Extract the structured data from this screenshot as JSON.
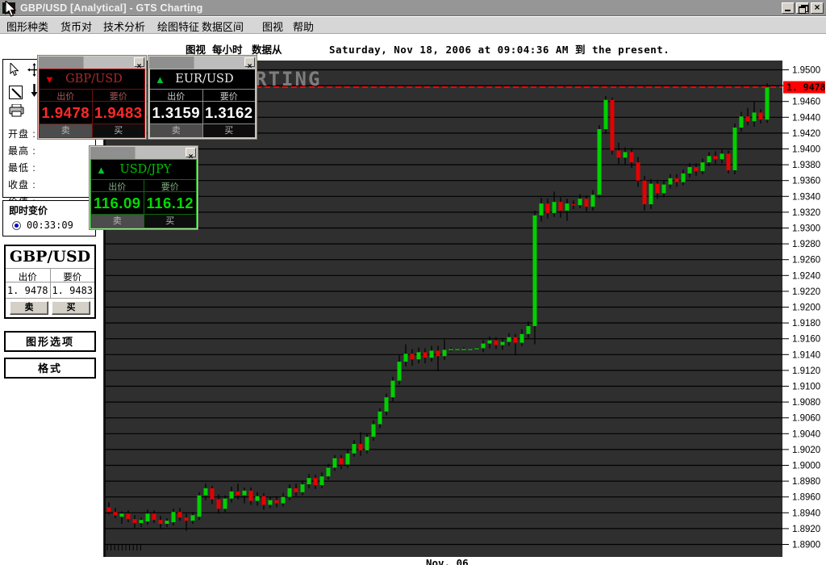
{
  "window": {
    "title": "GBP/USD [Analytical]  - GTS Charting"
  },
  "menu": {
    "items": [
      "图形种类",
      "货币对",
      "技术分析",
      "绘图特征",
      "数据区间",
      "图视",
      "帮助"
    ]
  },
  "info_bar": {
    "view": "图视",
    "interval": "每小时",
    "from_label": "数据从",
    "range": "Saturday, Nov 18, 2006 at 09:04:36 AM 到  the present."
  },
  "quote_panels": [
    {
      "pair": "GBP/USD",
      "direction": "down",
      "bid_label": "出价",
      "ask_label": "要价",
      "bid": "1.9478",
      "ask": "1.9483",
      "sell": "卖",
      "buy": "买",
      "accent": "#ff2a2a"
    },
    {
      "pair": "EUR/USD",
      "direction": "up",
      "bid_label": "出价",
      "ask_label": "要价",
      "bid": "1.3159",
      "ask": "1.3162",
      "sell": "卖",
      "buy": "买",
      "accent": "#ffffff"
    },
    {
      "pair": "USD/JPY",
      "direction": "up",
      "bid_label": "出价",
      "ask_label": "要价",
      "bid": "116.09",
      "ask": "116.12",
      "sell": "卖",
      "buy": "买",
      "accent": "#00dc00"
    }
  ],
  "sidebar": {
    "stats": [
      "开盘 :",
      "最高 :",
      "最低 :",
      "收盘 :",
      "价值 :"
    ],
    "tick_panel": {
      "label": "即时变价",
      "time": "00:33:09"
    },
    "quote_box": {
      "pair": "GBP/USD",
      "bid_label": "出价",
      "ask_label": "要价",
      "bid": "1. 9478",
      "ask": "1. 9483",
      "sell": "卖",
      "buy": "买"
    },
    "buttons": {
      "graph_options": "图形选项",
      "format": "格式"
    }
  },
  "chart_data": {
    "type": "candlestick",
    "pair": "GBP/USD",
    "interval": "hourly",
    "watermark": "GTS CHARTING",
    "x_label": "Nov, 06",
    "y_axis": {
      "min": 1.89,
      "max": 1.95,
      "tick_step": 0.002
    },
    "current_price": 1.9478,
    "price_tag": "1. 9478",
    "colors": {
      "background": "#2f2f2f",
      "grid": "#000000",
      "up": "#00d000",
      "down": "#e60000",
      "wick": "#000000",
      "dashed_line": "#ff0000",
      "tag_bg": "#ff0000",
      "tag_text": "#000000",
      "watermark": "#7d7d7d",
      "axis_text": "#000000"
    },
    "candles": [
      [
        1.8947,
        1.8953,
        1.8938,
        1.8941
      ],
      [
        1.8941,
        1.8946,
        1.8933,
        1.8937
      ],
      [
        1.8935,
        1.8942,
        1.8926,
        1.8939
      ],
      [
        1.8939,
        1.8943,
        1.8928,
        1.8932
      ],
      [
        1.8932,
        1.8937,
        1.8921,
        1.8927
      ],
      [
        1.8927,
        1.8934,
        1.8922,
        1.8931
      ],
      [
        1.8929,
        1.8944,
        1.8925,
        1.8939
      ],
      [
        1.8939,
        1.8943,
        1.8927,
        1.8931
      ],
      [
        1.8931,
        1.8936,
        1.892,
        1.8926
      ],
      [
        1.8926,
        1.8933,
        1.8922,
        1.893
      ],
      [
        1.8928,
        1.8945,
        1.8924,
        1.8941
      ],
      [
        1.8941,
        1.8946,
        1.893,
        1.8934
      ],
      [
        1.8934,
        1.8939,
        1.8917,
        1.893
      ],
      [
        1.893,
        1.8941,
        1.8926,
        1.8937
      ],
      [
        1.8935,
        1.8966,
        1.8931,
        1.8962
      ],
      [
        1.8962,
        1.8977,
        1.8956,
        1.8971
      ],
      [
        1.8971,
        1.8974,
        1.8951,
        1.8957
      ],
      [
        1.8957,
        1.8963,
        1.8939,
        1.8945
      ],
      [
        1.8945,
        1.8962,
        1.8941,
        1.8958
      ],
      [
        1.8958,
        1.8973,
        1.8953,
        1.8967
      ],
      [
        1.8967,
        1.8977,
        1.8957,
        1.8962
      ],
      [
        1.8962,
        1.8972,
        1.8952,
        1.8968
      ],
      [
        1.8968,
        1.8972,
        1.895,
        1.8955
      ],
      [
        1.8955,
        1.8966,
        1.8949,
        1.8961
      ],
      [
        1.8961,
        1.8965,
        1.8944,
        1.895
      ],
      [
        1.895,
        1.896,
        1.8946,
        1.8956
      ],
      [
        1.8956,
        1.8961,
        1.8947,
        1.8952
      ],
      [
        1.8952,
        1.8965,
        1.8948,
        1.896
      ],
      [
        1.896,
        1.8976,
        1.8956,
        1.8971
      ],
      [
        1.8971,
        1.8977,
        1.8961,
        1.8966
      ],
      [
        1.8966,
        1.8981,
        1.8962,
        1.8976
      ],
      [
        1.8976,
        1.8989,
        1.8971,
        1.8984
      ],
      [
        1.8984,
        1.8988,
        1.897,
        1.8975
      ],
      [
        1.8975,
        1.8991,
        1.8971,
        1.8986
      ],
      [
        1.8986,
        1.9002,
        1.8982,
        1.8997
      ],
      [
        1.8997,
        1.9013,
        1.8993,
        1.9009
      ],
      [
        1.9009,
        1.9013,
        1.8995,
        1.9001
      ],
      [
        1.9001,
        1.902,
        1.8997,
        1.9015
      ],
      [
        1.9015,
        1.9032,
        1.9011,
        1.9027
      ],
      [
        1.9027,
        1.9042,
        1.9012,
        1.9019
      ],
      [
        1.9019,
        1.904,
        1.9015,
        1.9036
      ],
      [
        1.9036,
        1.9057,
        1.9031,
        1.9052
      ],
      [
        1.9052,
        1.9072,
        1.9047,
        1.9068
      ],
      [
        1.9068,
        1.9091,
        1.9063,
        1.9086
      ],
      [
        1.9086,
        1.9112,
        1.9081,
        1.9107
      ],
      [
        1.9107,
        1.9139,
        1.9102,
        1.9131
      ],
      [
        1.9131,
        1.9153,
        1.9125,
        1.9141
      ],
      [
        1.9141,
        1.9147,
        1.9126,
        1.9134
      ],
      [
        1.9134,
        1.9149,
        1.9129,
        1.9143
      ],
      [
        1.9143,
        1.9148,
        1.9129,
        1.9136
      ],
      [
        1.9136,
        1.9151,
        1.9131,
        1.9145
      ],
      [
        1.9145,
        1.9151,
        1.9119,
        1.9138
      ],
      [
        1.9138,
        1.9159,
        1.9133,
        1.9146
      ],
      [
        1.9146,
        1.9149,
        1.9144,
        1.9147
      ],
      [
        1.9147,
        1.9148,
        1.9145,
        1.9147
      ],
      [
        1.9147,
        1.9149,
        1.9145,
        1.9147
      ],
      [
        1.9147,
        1.9148,
        1.9145,
        1.9147
      ],
      [
        1.9147,
        1.9149,
        1.9146,
        1.9148
      ],
      [
        1.9148,
        1.9158,
        1.9143,
        1.9154
      ],
      [
        1.9154,
        1.9163,
        1.9148,
        1.9158
      ],
      [
        1.9158,
        1.9162,
        1.9147,
        1.9152
      ],
      [
        1.9152,
        1.9161,
        1.9146,
        1.9156
      ],
      [
        1.9156,
        1.9167,
        1.9151,
        1.9162
      ],
      [
        1.9162,
        1.9166,
        1.9139,
        1.9155
      ],
      [
        1.9155,
        1.9172,
        1.9151,
        1.9166
      ],
      [
        1.9166,
        1.9182,
        1.9161,
        1.9176
      ],
      [
        1.9176,
        1.9322,
        1.9153,
        1.9316
      ],
      [
        1.9316,
        1.9338,
        1.9308,
        1.9331
      ],
      [
        1.9331,
        1.9337,
        1.9312,
        1.9319
      ],
      [
        1.9319,
        1.9346,
        1.9314,
        1.9333
      ],
      [
        1.9333,
        1.9339,
        1.9313,
        1.9322
      ],
      [
        1.9322,
        1.9337,
        1.9309,
        1.9331
      ],
      [
        1.933,
        1.9335,
        1.9324,
        1.9329
      ],
      [
        1.9329,
        1.9343,
        1.9325,
        1.9337
      ],
      [
        1.9337,
        1.9341,
        1.9321,
        1.9327
      ],
      [
        1.9327,
        1.9348,
        1.9322,
        1.9342
      ],
      [
        1.9342,
        1.943,
        1.9338,
        1.9425
      ],
      [
        1.9425,
        1.9467,
        1.9419,
        1.9462
      ],
      [
        1.9462,
        1.9465,
        1.9393,
        1.9398
      ],
      [
        1.9398,
        1.9408,
        1.9381,
        1.9389
      ],
      [
        1.9389,
        1.9402,
        1.938,
        1.9396
      ],
      [
        1.9396,
        1.9401,
        1.9376,
        1.9383
      ],
      [
        1.9383,
        1.939,
        1.9352,
        1.936
      ],
      [
        1.936,
        1.9366,
        1.9322,
        1.933
      ],
      [
        1.933,
        1.9362,
        1.9324,
        1.9356
      ],
      [
        1.9356,
        1.9361,
        1.9337,
        1.9344
      ],
      [
        1.9344,
        1.936,
        1.9339,
        1.9355
      ],
      [
        1.9355,
        1.9368,
        1.935,
        1.9363
      ],
      [
        1.9363,
        1.9368,
        1.9352,
        1.9358
      ],
      [
        1.9358,
        1.9374,
        1.9354,
        1.9369
      ],
      [
        1.9369,
        1.9382,
        1.9364,
        1.9377
      ],
      [
        1.9377,
        1.9382,
        1.9366,
        1.9372
      ],
      [
        1.9372,
        1.9388,
        1.9368,
        1.9383
      ],
      [
        1.9383,
        1.9396,
        1.9378,
        1.9391
      ],
      [
        1.9391,
        1.9397,
        1.9381,
        1.9387
      ],
      [
        1.9387,
        1.9399,
        1.9382,
        1.9394
      ],
      [
        1.9394,
        1.9398,
        1.9369,
        1.9373
      ],
      [
        1.9373,
        1.9432,
        1.9368,
        1.9427
      ],
      [
        1.9427,
        1.9447,
        1.9422,
        1.9441
      ],
      [
        1.9441,
        1.9452,
        1.943,
        1.9435
      ],
      [
        1.9435,
        1.946,
        1.9428,
        1.9446
      ],
      [
        1.9446,
        1.945,
        1.9432,
        1.9437
      ],
      [
        1.9437,
        1.9483,
        1.9433,
        1.9478
      ]
    ]
  }
}
